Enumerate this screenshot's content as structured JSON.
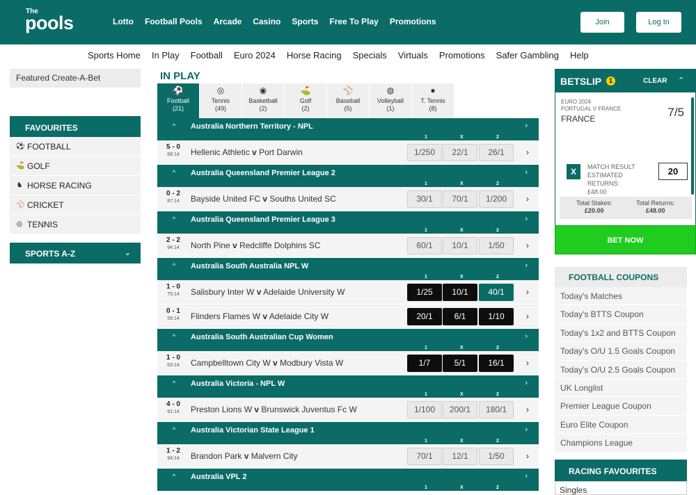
{
  "logo": {
    "top": "The",
    "main": "pools"
  },
  "main_nav": [
    "Lotto",
    "Football Pools",
    "Arcade",
    "Casino",
    "Sports",
    "Free To Play",
    "Promotions"
  ],
  "auth": {
    "join": "Join",
    "login": "Log In"
  },
  "sub_nav": [
    "Sports Home",
    "In Play",
    "Football",
    "Euro 2024",
    "Horse Racing",
    "Specials",
    "Virtuals",
    "Promotions",
    "Safer Gambling",
    "Help"
  ],
  "sidebar": {
    "featured": "Featured Create-A-Bet",
    "favourites_title": "FAVOURITES",
    "favourites": [
      {
        "label": "FOOTBALL",
        "icon": "football-icon"
      },
      {
        "label": "GOLF",
        "icon": "golf-icon"
      },
      {
        "label": "HORSE RACING",
        "icon": "horse-racing-icon"
      },
      {
        "label": "CRICKET",
        "icon": "cricket-icon"
      },
      {
        "label": "TENNIS",
        "icon": "tennis-icon"
      }
    ],
    "sports_az": "SPORTS A-Z"
  },
  "inplay": {
    "title": "IN PLAY",
    "tabs": [
      {
        "label": "Football",
        "count": "(21)",
        "icon": "football-icon"
      },
      {
        "label": "Tennis",
        "count": "(49)",
        "icon": "tennis-icon"
      },
      {
        "label": "Basketball",
        "count": "(2)",
        "icon": "basketball-icon"
      },
      {
        "label": "Golf",
        "count": "(2)",
        "icon": "golf-icon"
      },
      {
        "label": "Baseball",
        "count": "(5)",
        "icon": "baseball-icon"
      },
      {
        "label": "Volleyball",
        "count": "(1)",
        "icon": "volleyball-icon"
      },
      {
        "label": "T. Tennis",
        "count": "(8)",
        "icon": "table-tennis-icon"
      }
    ],
    "headers": [
      "1",
      "X",
      "2"
    ],
    "competitions": [
      {
        "name": "Australia Northern Territory - NPL",
        "matches": [
          {
            "score": "5 - 0",
            "time": "68:14",
            "home": "Hellenic Athletic",
            "away": "Port Darwin",
            "odds": [
              "1/250",
              "22/1",
              "26/1"
            ],
            "style": [
              "light",
              "light",
              "light"
            ]
          }
        ]
      },
      {
        "name": "Australia Queensland Premier League 2",
        "matches": [
          {
            "score": "0 - 2",
            "time": "87:14",
            "home": "Bayside United FC",
            "away": "Souths United SC",
            "odds": [
              "30/1",
              "70/1",
              "1/200"
            ],
            "style": [
              "light",
              "light",
              "light"
            ]
          }
        ]
      },
      {
        "name": "Australia Queensland Premier League 3",
        "matches": [
          {
            "score": "2 - 2",
            "time": "94:14",
            "home": "North Pine",
            "away": "Redcliffe Dolphins SC",
            "odds": [
              "60/1",
              "10/1",
              "1/50"
            ],
            "style": [
              "light",
              "light",
              "light"
            ]
          }
        ]
      },
      {
        "name": "Australia South Australia NPL W",
        "matches": [
          {
            "score": "1 - 0",
            "time": "75:14",
            "home": "Salisbury Inter W",
            "away": "Adelaide University W",
            "odds": [
              "1/25",
              "10/1",
              "40/1"
            ],
            "style": [
              "dark",
              "dark",
              "sel"
            ]
          },
          {
            "score": "0 - 1",
            "time": "59:14",
            "home": "Flinders Flames W",
            "away": "Adelaide City W",
            "odds": [
              "20/1",
              "6/1",
              "1/10"
            ],
            "style": [
              "dark",
              "dark",
              "dark"
            ]
          }
        ]
      },
      {
        "name": "Australia South Australian Cup Women",
        "matches": [
          {
            "score": "1 - 0",
            "time": "63:14",
            "home": "Campbelltown City W",
            "away": "Modbury Vista W",
            "odds": [
              "1/7",
              "5/1",
              "16/1"
            ],
            "style": [
              "dark",
              "dark",
              "dark"
            ]
          }
        ]
      },
      {
        "name": "Australia Victoria - NPL W",
        "matches": [
          {
            "score": "4 - 0",
            "time": "91:14",
            "home": "Preston Lions W",
            "away": "Brunswick Juventus Fc W",
            "odds": [
              "1/100",
              "200/1",
              "180/1"
            ],
            "style": [
              "light",
              "light",
              "light"
            ]
          }
        ]
      },
      {
        "name": "Australia Victorian State League 1",
        "matches": [
          {
            "score": "1 - 2",
            "time": "94:14",
            "home": "Brandon Park",
            "away": "Malvern City",
            "odds": [
              "70/1",
              "12/1",
              "1/50"
            ],
            "style": [
              "light",
              "light",
              "light"
            ]
          }
        ]
      },
      {
        "name": "Australia VPL 2",
        "matches": []
      }
    ],
    "vs": "v"
  },
  "betslip": {
    "title": "BETSLIP",
    "count": "1",
    "clear": "CLEAR",
    "event_line1": "EURO 2024",
    "event_line2": "PORTUGAL V FRANCE",
    "selection": "FRANCE",
    "price": "7/5",
    "remove": "X",
    "market": "MATCH RESULT ESTIMATED RETURNS:",
    "est_returns": "£48.00",
    "stake": "20",
    "total_stakes_label": "Total Stakes:",
    "total_stakes": "£20.00",
    "total_returns_label": "Total Returns:",
    "total_returns": "£48.00",
    "bet_now": "BET NOW"
  },
  "football_coupons": {
    "title": "FOOTBALL COUPONS",
    "items": [
      "Today's Matches",
      "Today's BTTS Coupon",
      "Today's 1x2 and BTTS Coupon",
      "Today's O/U 1.5 Goals Coupon",
      "Today's O/U 2.5 Goals Coupon",
      "UK Longlist",
      "Premier League Coupon",
      "Euro Elite Coupon",
      "Champions League"
    ]
  },
  "racing_favourites": {
    "title": "RACING FAVOURITES",
    "first": "Singles"
  },
  "colors": {
    "brand": "#0b6b66",
    "bet_now": "#1fcc1f",
    "badge": "#f5d000"
  }
}
